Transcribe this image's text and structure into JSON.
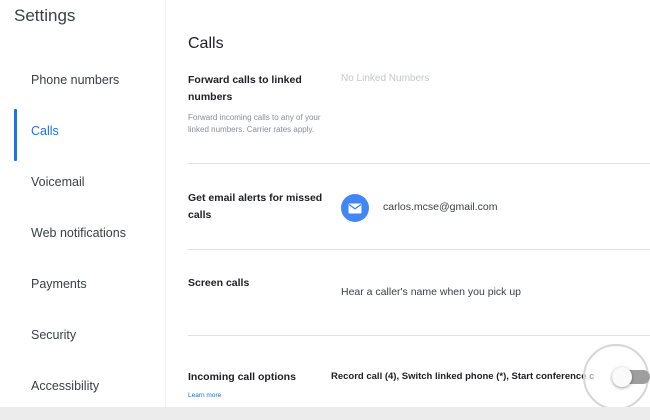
{
  "app": {
    "title": "Settings"
  },
  "sidebar": {
    "items": [
      {
        "label": "Phone numbers"
      },
      {
        "label": "Calls",
        "active": true
      },
      {
        "label": "Voicemail"
      },
      {
        "label": "Web notifications"
      },
      {
        "label": "Payments"
      },
      {
        "label": "Security"
      },
      {
        "label": "Accessibility"
      }
    ]
  },
  "main": {
    "section_title": "Calls",
    "forward": {
      "label": "Forward calls to linked numbers",
      "help": "Forward incoming calls to any of your linked numbers. Carrier rates apply.",
      "value": "No Linked Numbers"
    },
    "email_alerts": {
      "label": "Get email alerts for missed calls",
      "email": "carlos.mcse@gmail.com",
      "icon": "mail-icon"
    },
    "screen_calls": {
      "label": "Screen calls",
      "description": "Hear a caller's name when you pick up"
    },
    "incoming_options": {
      "label": "Incoming call options",
      "description": "Record call (4), Switch linked phone (*), Start conference c",
      "learn_more": "Learn more",
      "toggle_on": false
    }
  },
  "colors": {
    "accent": "#1a73e8",
    "mail_badge": "#4285f4"
  }
}
